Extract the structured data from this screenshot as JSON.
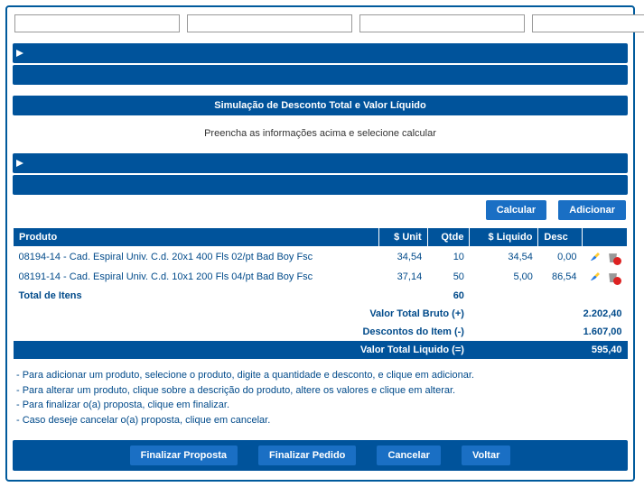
{
  "simulation": {
    "title": "Simulação de Desconto Total e Valor Líquido",
    "hint": "Preencha as informações acima e selecione calcular"
  },
  "buttons": {
    "calcular": "Calcular",
    "adicionar": "Adicionar",
    "finalizar_proposta": "Finalizar Proposta",
    "finalizar_pedido": "Finalizar Pedido",
    "cancelar": "Cancelar",
    "voltar": "Voltar"
  },
  "table": {
    "headers": {
      "produto": "Produto",
      "unit": "$ Unit",
      "qtde": "Qtde",
      "liquido": "$ Liquido",
      "desc": "Desc"
    },
    "rows": [
      {
        "produto": "08194-14 - Cad. Espiral Univ. C.d. 20x1 400 Fls 02/pt Bad Boy Fsc",
        "unit": "34,54",
        "qtde": "10",
        "liquido": "34,54",
        "desc": "0,00"
      },
      {
        "produto": "08191-14 - Cad. Espiral Univ. C.d. 10x1 200 Fls 04/pt Bad Boy Fsc",
        "unit": "37,14",
        "qtde": "50",
        "liquido": "5,00",
        "desc": "86,54"
      }
    ],
    "total_label": "Total de Itens",
    "total_qtde": "60"
  },
  "summary": {
    "bruto_label": "Valor Total Bruto (+)",
    "bruto_val": "2.202,40",
    "desc_label": "Descontos do Item (-)",
    "desc_val": "1.607,00",
    "liq_label": "Valor Total Liquido (=)",
    "liq_val": "595,40"
  },
  "notes": {
    "l1": "- Para adicionar um produto, selecione o produto, digite a quantidade e desconto, e clique em adicionar.",
    "l2": "- Para alterar um produto, clique sobre a descrição do produto, altere os valores e clique em alterar.",
    "l3": "- Para finalizar o(a) proposta, clique em finalizar.",
    "l4": "- Caso deseje cancelar o(a) proposta, clique em cancelar."
  }
}
